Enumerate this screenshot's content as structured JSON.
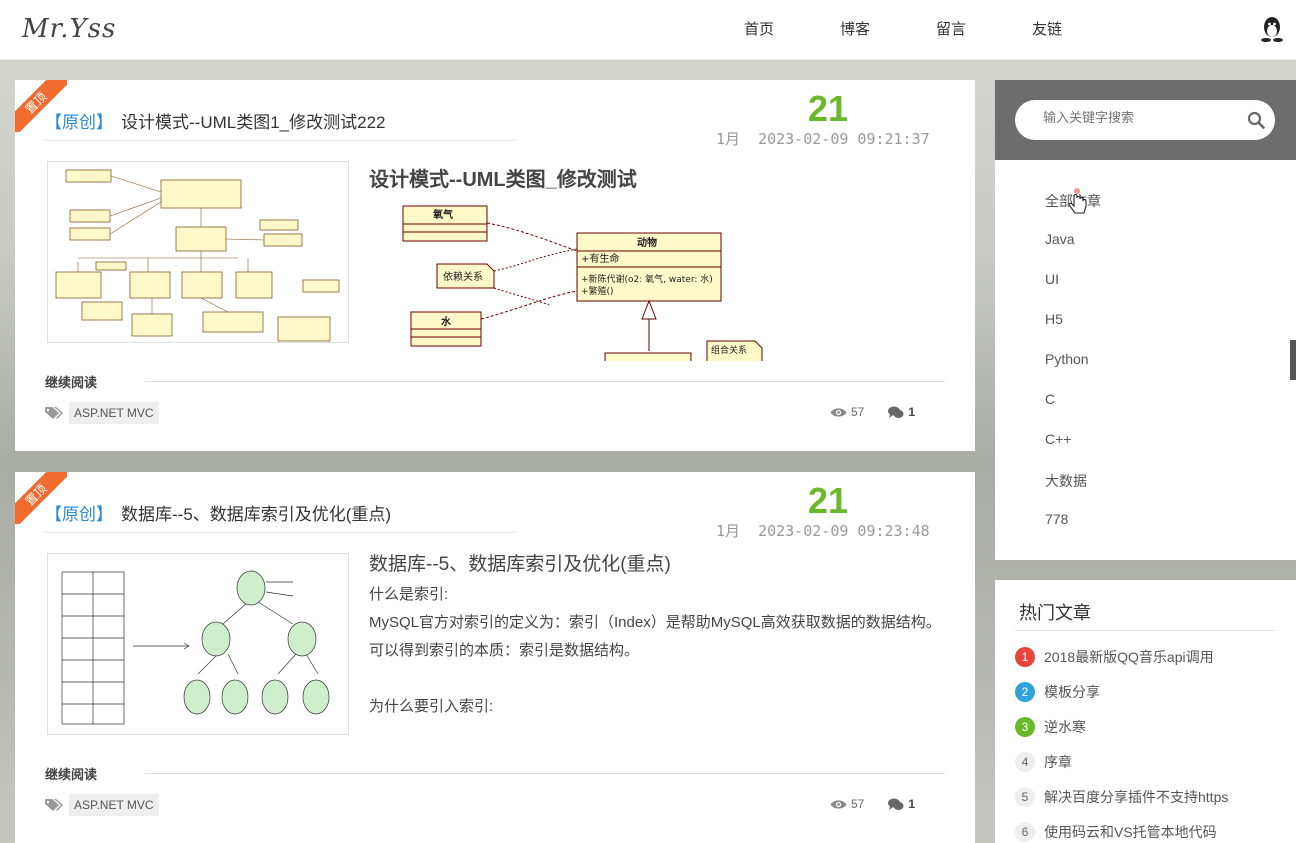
{
  "header": {
    "logo": "Mr.Yss",
    "nav": [
      "首页",
      "博客",
      "留言",
      "友链"
    ]
  },
  "articles": [
    {
      "ribbon": "置顶",
      "tag": "【原创】",
      "title": "设计模式--UML类图1_修改测试222",
      "day": "21",
      "month": "1月",
      "datetime": "2023-02-09 09:21:37",
      "excerpt_heading": "设计模式--UML类图_修改测试",
      "read_more": "继续阅读",
      "category": "ASP.NET MVC",
      "views": "57",
      "comments": "1",
      "uml_labels": {
        "oxygen": "氧气",
        "water": "水",
        "animal": "动物",
        "animal_attr": "+有生命",
        "animal_m1": "+新陈代谢(o2: 氧气, water: 水)",
        "animal_m2": "+繁殖()",
        "dep_note": "依赖关系",
        "comp_note": "组合关系"
      }
    },
    {
      "ribbon": "置顶",
      "tag": "【原创】",
      "title": "数据库--5、数据库索引及优化(重点)",
      "day": "21",
      "month": "1月",
      "datetime": "2023-02-09 09:23:48",
      "excerpt_heading": "数据库--5、数据库索引及优化(重点)",
      "excerpt_lines": [
        "什么是索引:",
        "MySQL官方对索引的定义为：索引（Index）是帮助MySQL高效获取数据的数据结构。",
        "可以得到索引的本质：索引是数据结构。",
        "",
        "为什么要引入索引:"
      ],
      "read_more": "继续阅读",
      "category": "ASP.NET MVC",
      "views": "57",
      "comments": "1"
    }
  ],
  "sidebar": {
    "search_placeholder": "输入关键字搜索",
    "categories": [
      "全部文章",
      "Java",
      "UI",
      "H5",
      "Python",
      "C",
      "C++",
      "大数据",
      "778"
    ],
    "hot_title": "热门文章",
    "hot_articles": [
      {
        "rank": "1",
        "title": "2018最新版QQ音乐api调用"
      },
      {
        "rank": "2",
        "title": "模板分享"
      },
      {
        "rank": "3",
        "title": "逆水寒"
      },
      {
        "rank": "4",
        "title": "序章"
      },
      {
        "rank": "5",
        "title": "解决百度分享插件不支持https"
      },
      {
        "rank": "6",
        "title": "使用码云和VS托管本地代码"
      }
    ]
  },
  "colors": {
    "accent_green": "#6ab82b",
    "tag_blue": "#2a8ad4",
    "ribbon_orange": "#f26a2e",
    "rank1": "#e8453c",
    "rank2": "#2fa2dc",
    "rank3": "#6ab82b"
  }
}
